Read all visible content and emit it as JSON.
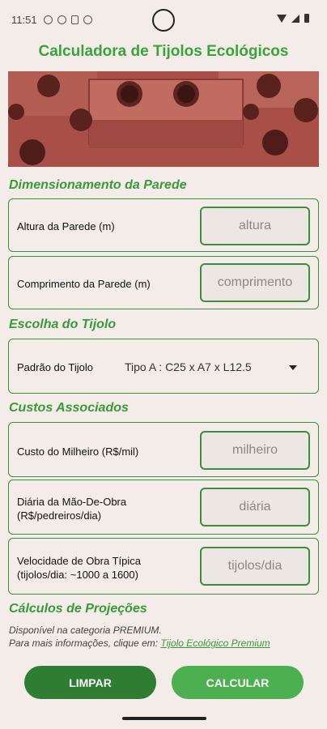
{
  "status_bar": {
    "time": "11:51"
  },
  "app": {
    "title": "Calculadora de Tijolos Ecológicos"
  },
  "sections": {
    "wall": "Dimensionamento da Parede",
    "brick": "Escolha do Tijolo",
    "costs": "Custos Associados",
    "projections": "Cálculos de Projeções"
  },
  "fields": {
    "height": {
      "label": "Altura da Parede (m)",
      "placeholder": "altura"
    },
    "length": {
      "label": "Comprimento da Parede (m)",
      "placeholder": "comprimento"
    },
    "brick_type": {
      "label": "Padrão do Tijolo",
      "value": "Tipo A : C25 x A7  x L12.5"
    },
    "thousand_cost": {
      "label": "Custo do Milheiro (R$/mil)",
      "placeholder": "milheiro"
    },
    "daily_labor": {
      "label_line1": "Diária da Mão-De-Obra",
      "label_line2": "(R$/pedreiros/dia)",
      "placeholder": "diária"
    },
    "work_speed": {
      "label_line1": "Velocidade de Obra Típica",
      "label_line2": "(tijolos/dia: ~1000 a 1600)",
      "placeholder": "tijolos/dia"
    }
  },
  "info": {
    "line1": "Disponível na categoria PREMIUM.",
    "line2": "Para mais informações, clique em: ",
    "link": "Tijolo Ecológico Premium"
  },
  "buttons": {
    "clear": "LIMPAR",
    "calculate": "CALCULAR"
  },
  "colors": {
    "accent": "#3aa43a",
    "button_dark": "#2e7d32",
    "button_light": "#4caf50"
  }
}
